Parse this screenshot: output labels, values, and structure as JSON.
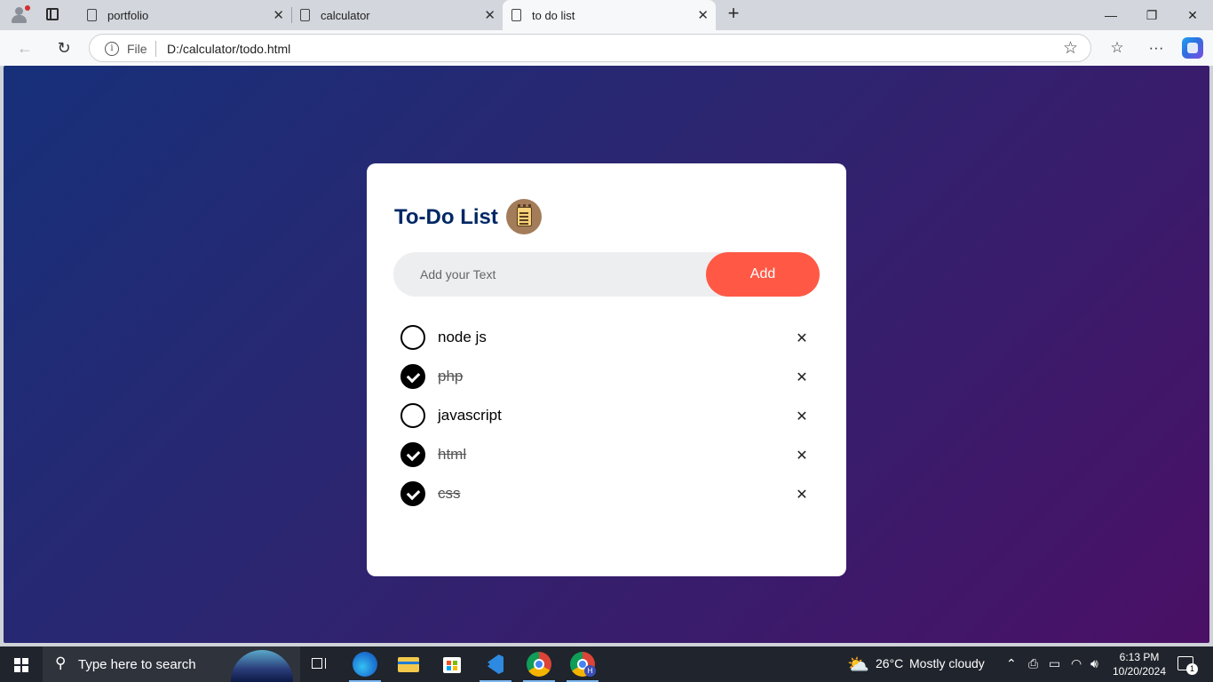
{
  "browser": {
    "tabs": [
      {
        "title": "portfolio",
        "active": false
      },
      {
        "title": "calculator",
        "active": false
      },
      {
        "title": "to do list",
        "active": true
      }
    ],
    "address": {
      "scheme_label": "File",
      "url": "D:/calculator/todo.html"
    }
  },
  "todo": {
    "title": "To-Do List",
    "input_placeholder": "Add your Text",
    "add_label": "Add",
    "items": [
      {
        "text": "node js",
        "checked": false
      },
      {
        "text": "php",
        "checked": true
      },
      {
        "text": "javascript",
        "checked": false
      },
      {
        "text": "html",
        "checked": true
      },
      {
        "text": "css",
        "checked": true
      }
    ],
    "colors": {
      "title": "#002765",
      "button": "#ff5945",
      "input_bg": "#edeef0"
    }
  },
  "taskbar": {
    "search_placeholder": "Type here to search",
    "weather": "26°C",
    "weather_desc": "Mostly cloudy",
    "time": "6:13 PM",
    "date": "10/20/2024",
    "notification_count": "1"
  }
}
